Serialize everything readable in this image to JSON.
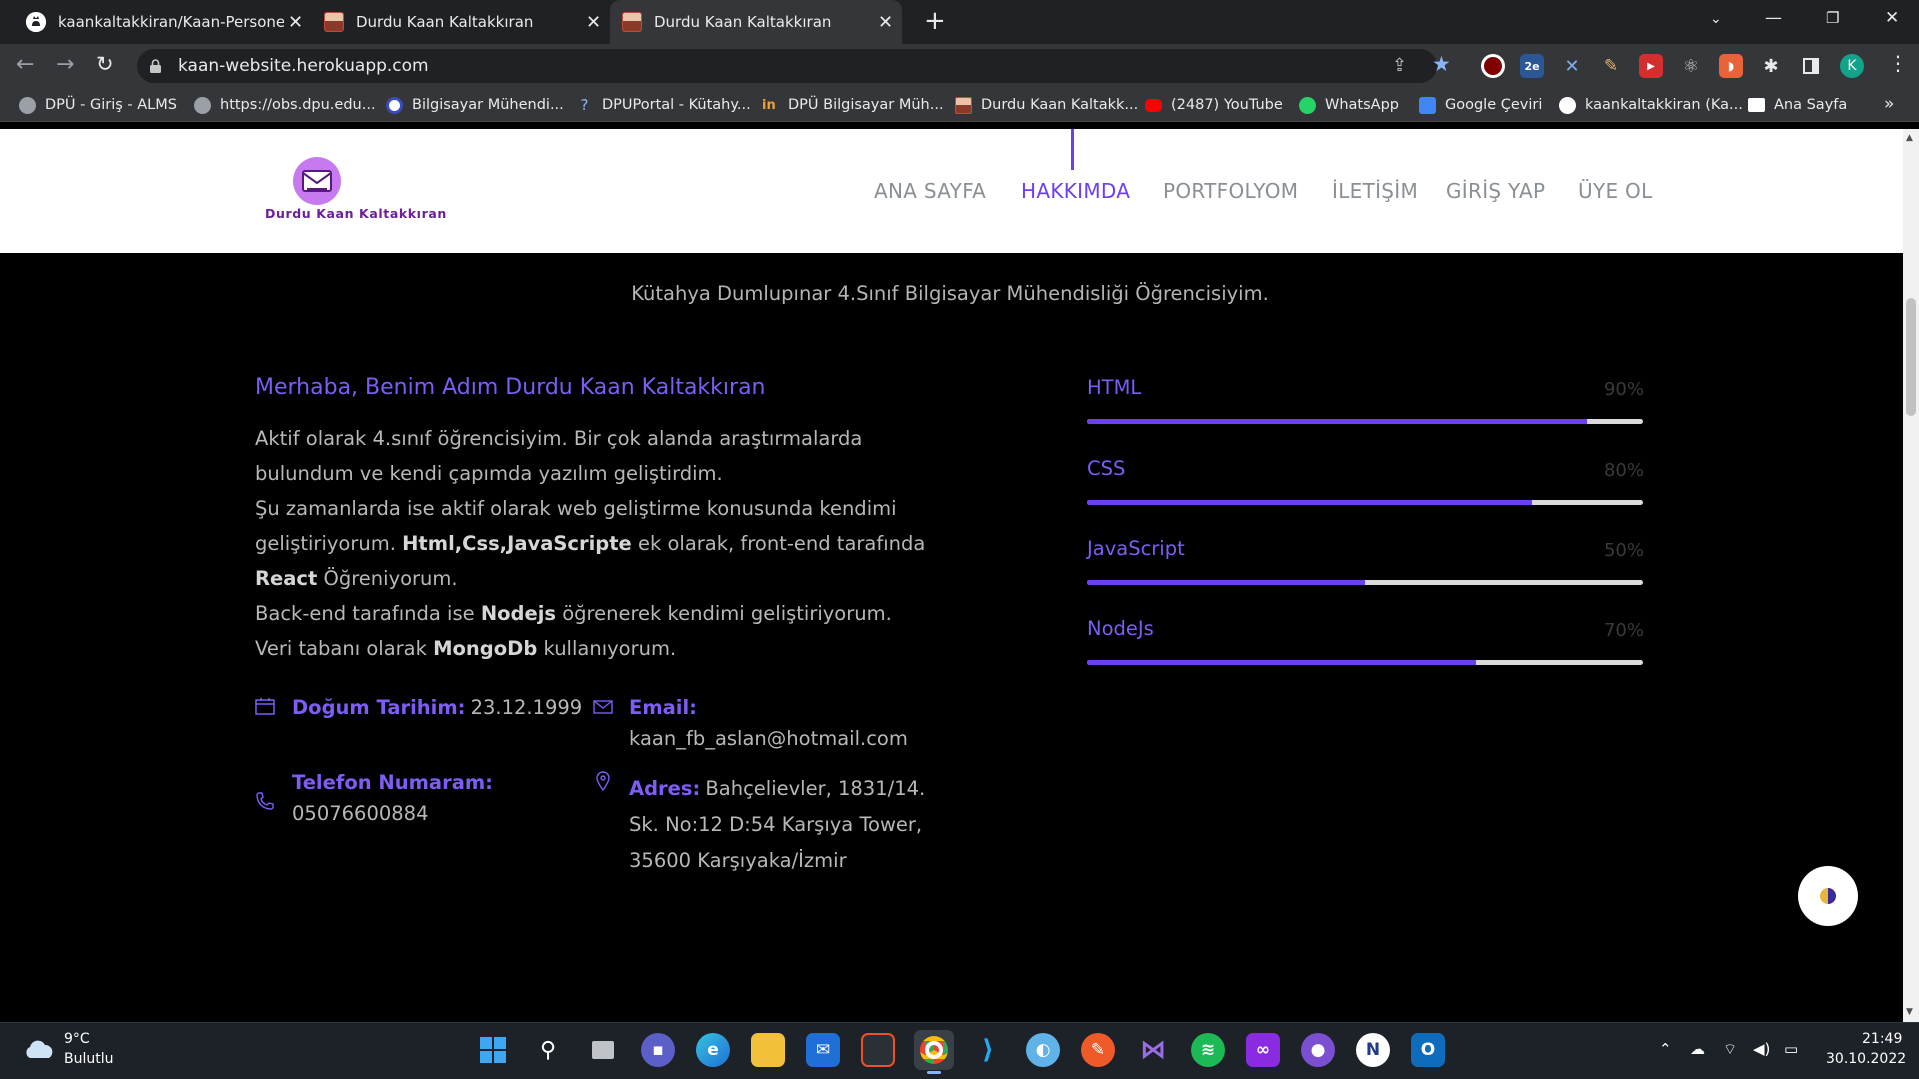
{
  "browser": {
    "tabs": [
      {
        "title": "kaankaltakkiran/Kaan-Personel-W",
        "favicon": "github-icon"
      },
      {
        "title": "Durdu Kaan Kaltakkıran",
        "favicon": "profile-photo"
      },
      {
        "title": "Durdu Kaan Kaltakkıran",
        "favicon": "profile-photo",
        "active": true
      }
    ],
    "url": "kaan-website.herokuapp.com",
    "profile_initial": "K",
    "bookmarks": [
      {
        "label": "DPÜ - Giriş - ALMS",
        "icon": "globe-icon"
      },
      {
        "label": "https://obs.dpu.edu...",
        "icon": "globe-icon"
      },
      {
        "label": "Bilgisayar Mühendi...",
        "icon": "info-icon"
      },
      {
        "label": "DPUPortal - Kütahy...",
        "icon": "portal-icon"
      },
      {
        "label": "DPÜ Bilgisayar Müh...",
        "icon": "linkedin-icon"
      },
      {
        "label": "Durdu Kaan Kaltakk...",
        "icon": "profile-photo"
      },
      {
        "label": "(2487) YouTube",
        "icon": "youtube-icon"
      },
      {
        "label": "WhatsApp",
        "icon": "whatsapp-icon"
      },
      {
        "label": "Google Çeviri",
        "icon": "translate-icon"
      },
      {
        "label": "kaankaltakkiran (Ka...",
        "icon": "github-icon"
      },
      {
        "label": "Ana Sayfa",
        "icon": "btk-icon"
      }
    ],
    "extensions": [
      "ublock",
      "2e",
      "tool",
      "paint",
      "yt",
      "react",
      "rss",
      "puzzle",
      "sidebar"
    ]
  },
  "site": {
    "logo_text": "Durdu Kaan Kaltakkıran",
    "nav": [
      "ANA SAYFA",
      "HAKKIMDA",
      "PORTFOLYOM",
      "İLETİŞİM",
      "GİRİŞ YAP",
      "ÜYE OL"
    ],
    "active_nav": "HAKKIMDA",
    "subtitle": "Kütahya Dumlupınar 4.Sınıf Bilgisayar Mühendisliği Öğrencisiyim.",
    "about": {
      "heading": "Merhaba, Benim Adım Durdu Kaan Kaltakkıran",
      "bio": {
        "p1": "Aktif olarak 4.sınıf öğrencisiyim. Bir çok alanda araştırmalarda bulundum ve kendi çapımda yazılım geliştirdim.",
        "p2a": "Şu zamanlarda ise aktif olarak web geliştirme konusunda kendimi geliştiriyorum. ",
        "p2b": "Html,Css,JavaScripte",
        "p2c": " ek olarak, front-end tarafında ",
        "p2d": "React",
        "p2e": " Öğreniyorum.",
        "p3a": "Back-end tarafında ise ",
        "p3b": "Nodejs",
        "p3c": " öğrenerek kendimi geliştiriyorum.",
        "p4a": "Veri tabanı olarak ",
        "p4b": "MongoDb",
        "p4c": " kullanıyorum."
      },
      "birth_label": "Doğum Tarihim:",
      "birth_value": "23.12.1999",
      "phone_label": "Telefon Numaram:",
      "phone_value": "05076600884",
      "email_label": "Email:",
      "email_value": "kaan_fb_aslan@hotmail.com",
      "address_label": "Adres:",
      "address_l1": "Bahçelievler, 1831/14.",
      "address_l2": "Sk. No:12 D:54 Karşıya Tower,",
      "address_l3": "35600 Karşıyaka/İzmir"
    },
    "skills": [
      {
        "name": "HTML",
        "percent_label": "90%",
        "level": 0.9
      },
      {
        "name": "CSS",
        "percent_label": "80%",
        "level": 0.8
      },
      {
        "name": "JavaScript",
        "percent_label": "50%",
        "level": 0.5
      },
      {
        "name": "NodeJs",
        "percent_label": "70%",
        "level": 0.7
      }
    ],
    "accent_color": "#6c3ff0"
  },
  "taskbar": {
    "weather_temp": "9°C",
    "weather_desc": "Bulutlu",
    "time": "21:49",
    "date": "30.10.2022",
    "apps": [
      "windows-start",
      "search",
      "task-view",
      "teams-chat",
      "edge",
      "file-explorer",
      "mail",
      "store",
      "chrome",
      "vscode",
      "paint",
      "pen-app",
      "visual-studio",
      "spotify",
      "arduino",
      "github-desktop",
      "notes",
      "outlook"
    ]
  }
}
